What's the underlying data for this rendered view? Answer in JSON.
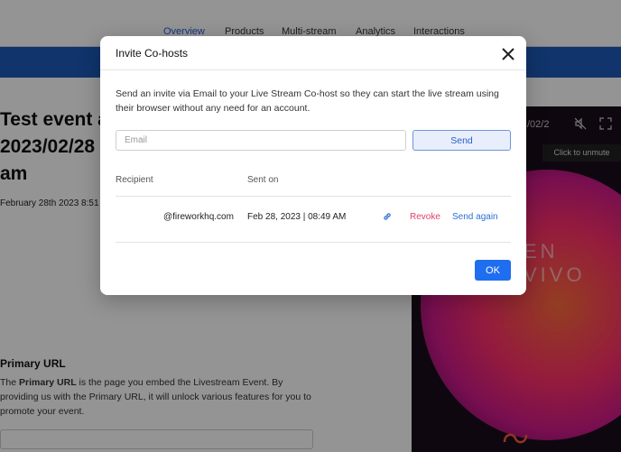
{
  "nav": {
    "tabs": [
      {
        "label": "Overview",
        "active": true
      },
      {
        "label": "Products"
      },
      {
        "label": "Multi-stream"
      },
      {
        "label": "Analytics"
      },
      {
        "label": "Interactions"
      }
    ]
  },
  "event": {
    "title": "Test event a 2023/02/28 am",
    "date": "February 28th 2023 8:51"
  },
  "primary_url": {
    "label": "Primary URL",
    "description_bold": "Primary URL",
    "description_pre": "The ",
    "description_post": " is the page you embed the Livestream Event. By providing us with the Primary URL, it will unlock various features for you to promote your event."
  },
  "video": {
    "time": "/02/2",
    "watermark": "EN VIVO",
    "unmute_tooltip": "Click to unmute"
  },
  "modal": {
    "title": "Invite Co-hosts",
    "description": "Send an invite via Email to your Live Stream Co-host so they can start the live stream using their browser without any need for an account.",
    "email_placeholder": "Email",
    "send_label": "Send",
    "columns": {
      "recipient": "Recipient",
      "sent_on": "Sent on"
    },
    "invite": {
      "recipient": "@fireworkhq.com",
      "sent_on": "Feb 28, 2023 | 08:49 AM",
      "revoke_label": "Revoke",
      "send_again_label": "Send again"
    },
    "ok_label": "OK"
  },
  "colors": {
    "accent": "#1f6ef0",
    "revoke": "#e0406a",
    "link": "#2b6fd6",
    "nav_bar": "#1d5bb8"
  },
  "icons": [
    "close-icon",
    "link-icon",
    "mute-icon",
    "fullscreen-icon"
  ]
}
